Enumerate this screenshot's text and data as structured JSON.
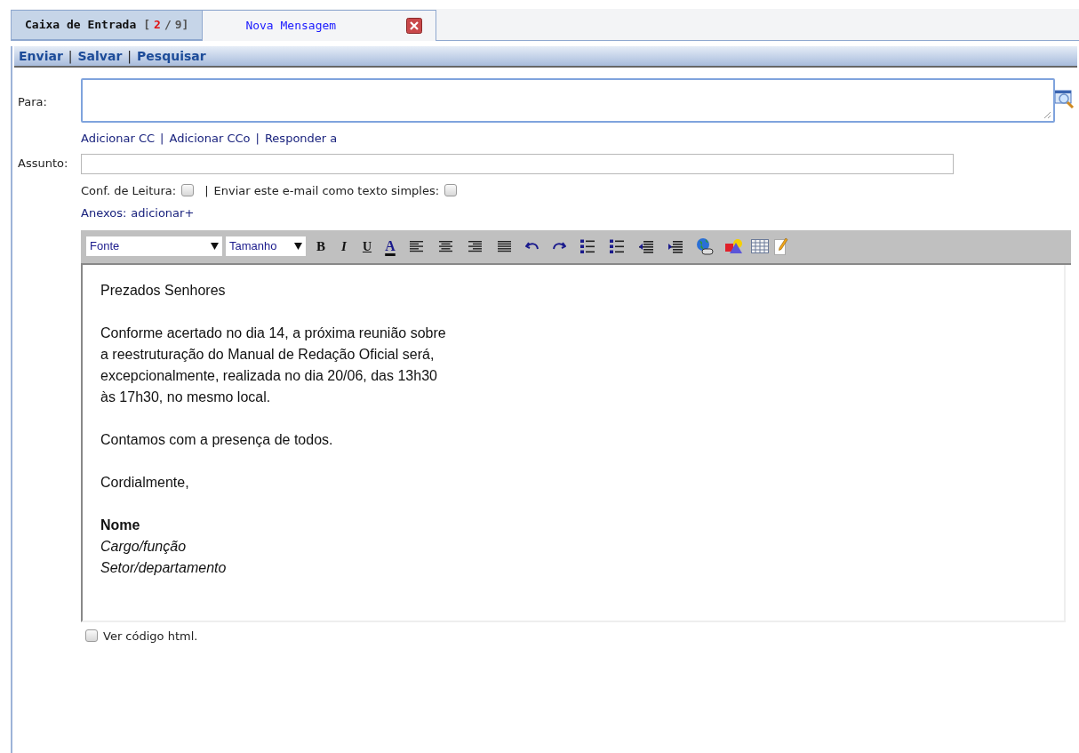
{
  "tabs": [
    {
      "label": "Caixa de Entrada",
      "selected": false,
      "counter": {
        "open": "[",
        "unread": "2",
        "separator": "/",
        "total": "9",
        "close": "]"
      }
    },
    {
      "label": "Nova Mensagem",
      "selected": true,
      "closable": true
    }
  ],
  "actions": {
    "separator": "|",
    "items": [
      "Enviar",
      "Salvar",
      "Pesquisar"
    ]
  },
  "form": {
    "to_label": "Para:",
    "recipient_links": {
      "separator": "|",
      "items": [
        "Adicionar CC",
        "Adicionar CCo",
        "Responder a"
      ]
    },
    "subject_label": "Assunto:",
    "read_receipt": {
      "label": "Conf. de Leitura:",
      "checked": false
    },
    "option_separator": "|",
    "plain_text": {
      "label": "Enviar este e-mail como texto simples:",
      "checked": false
    },
    "attachments_label": "Anexos:",
    "attachments_link": "adicionar+"
  },
  "editor_toolbar": [
    {
      "kind": "select",
      "label": "Fonte"
    },
    {
      "kind": "select",
      "label": "Tamanho"
    },
    {
      "kind": "bold",
      "label": "B"
    },
    {
      "kind": "italic",
      "label": "I"
    },
    {
      "kind": "underline",
      "label": "U"
    },
    {
      "kind": "color",
      "label": "A"
    },
    {
      "kind": "align-left"
    },
    {
      "kind": "align-center"
    },
    {
      "kind": "align-right"
    },
    {
      "kind": "justify"
    },
    {
      "kind": "undo"
    },
    {
      "kind": "redo"
    },
    {
      "kind": "ordered-list"
    },
    {
      "kind": "bullet-list"
    },
    {
      "kind": "outdent"
    },
    {
      "kind": "indent"
    },
    {
      "kind": "link"
    },
    {
      "kind": "image"
    },
    {
      "kind": "table"
    },
    {
      "kind": "edit"
    }
  ],
  "editor_body": [
    [
      {
        "text": "Prezados Senhores",
        "kind": "plain"
      }
    ],
    [
      {
        "text": "Conforme acertado no dia 14, a próxima reunião sobre",
        "kind": "plain"
      },
      {
        "text": "a reestruturação do Manual de Redação Oficial será,",
        "kind": "plain"
      },
      {
        "text": "excepcionalmente, realizada no dia 20/06, das 13h30",
        "kind": "plain"
      },
      {
        "text": "às 17h30, no mesmo local.",
        "kind": "plain"
      }
    ],
    [
      {
        "text": "Contamos com a presença de todos.",
        "kind": "plain"
      }
    ],
    [
      {
        "text": "Cordialmente,",
        "kind": "plain"
      }
    ],
    [
      {
        "text": "Nome",
        "kind": "name"
      },
      {
        "text": "Cargo/função",
        "kind": "role"
      },
      {
        "text": "Setor/departamento",
        "kind": "role"
      }
    ]
  ],
  "view_html": {
    "label": "Ver código html.",
    "checked": false
  }
}
